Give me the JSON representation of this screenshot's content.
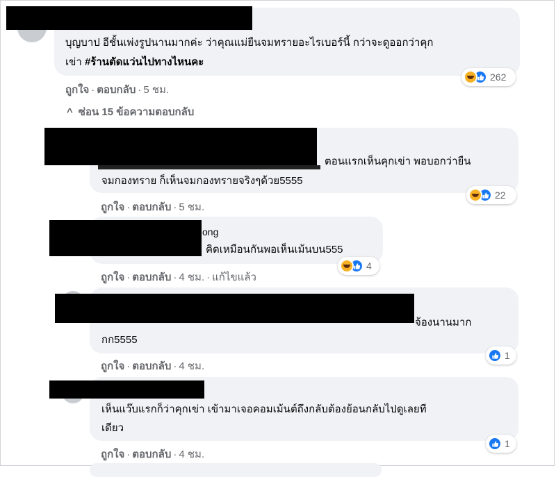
{
  "comments": [
    {
      "text_lines": [
        "บุญบาป อีชั้นเพ่งรูปนานมากค่ะ ว่าคุณแม่ยืนจมทรายอะไรเบอร์นี้ กว่าจะดูออกว่าคุก",
        "เข่า "
      ],
      "hashtag": "#ร้านตัดแว่นไปทางไหนคะ",
      "reaction_count": "262",
      "actions": {
        "like": "ถูกใจ",
        "reply": "ตอบกลับ",
        "time": "5 ชม."
      }
    },
    {
      "text_lines": [
        "ตอนแรกเห็นคุกเข่า พอบอกว่ายืน",
        "จมกองทราย ก็เห็นจมกองทรายจริงๆด้วย5555"
      ],
      "reaction_count": "22",
      "actions": {
        "like": "ถูกใจ",
        "reply": "ตอบกลับ",
        "time": "5 ชม."
      }
    },
    {
      "name_fragment": "ong",
      "text_lines": [
        "คิดเหมือนกันพอเห็นเม้นบน555"
      ],
      "reaction_count": "4",
      "actions": {
        "like": "ถูกใจ",
        "reply": "ตอบกลับ",
        "time": "4 ชม.",
        "edited": "แก้ไขแล้ว"
      }
    },
    {
      "text_lines": [
        "จ้องนานมาก",
        "กก5555"
      ],
      "reaction_count": "1",
      "actions": {
        "like": "ถูกใจ",
        "reply": "ตอบกลับ",
        "time": "4 ชม."
      }
    },
    {
      "text_lines": [
        "เห็นแว๊บแรกก็ว่าคุกเข่า เข้ามาเจอคอมเม้นต์ถึงกลับต้องย้อนกลับไปดูเลยที",
        "เดียว"
      ],
      "reaction_count": "1",
      "actions": {
        "like": "ถูกใจ",
        "reply": "ตอบกลับ",
        "time": "4 ชม."
      }
    }
  ],
  "hide_replies": {
    "label": "ซ่อน 15 ข้อความตอบกลับ",
    "icon": "chevron-up-icon"
  },
  "colors": {
    "bubble": "#f0f2f5",
    "meta_text": "#65676b",
    "like_blue": "#1877f2",
    "haha_yellow": "#f7b125"
  }
}
